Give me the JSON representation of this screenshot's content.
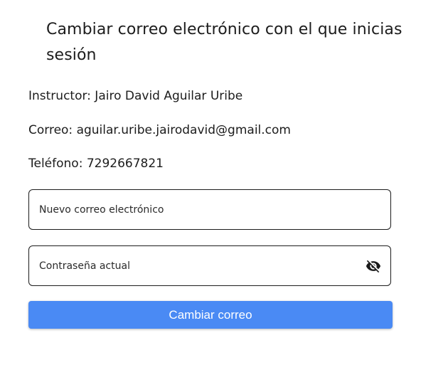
{
  "page": {
    "title": "Cambiar correo electrónico con el que inicias sesión"
  },
  "info": {
    "instructor": "Instructor: Jairo David Aguilar Uribe",
    "email": "Correo: aguilar.uribe.jairodavid@gmail.com",
    "phone": "Teléfono: 7292667821"
  },
  "form": {
    "new_email_label": "Nuevo correo electrónico",
    "new_email_value": "",
    "password_label": "Contraseña actual",
    "password_value": "",
    "password_toggle_icon": "eye-off-icon",
    "submit_label": "Cambiar correo"
  },
  "colors": {
    "button_bg": "#4a8af4",
    "button_text": "#ffffff",
    "border": "#1c1c1c"
  }
}
